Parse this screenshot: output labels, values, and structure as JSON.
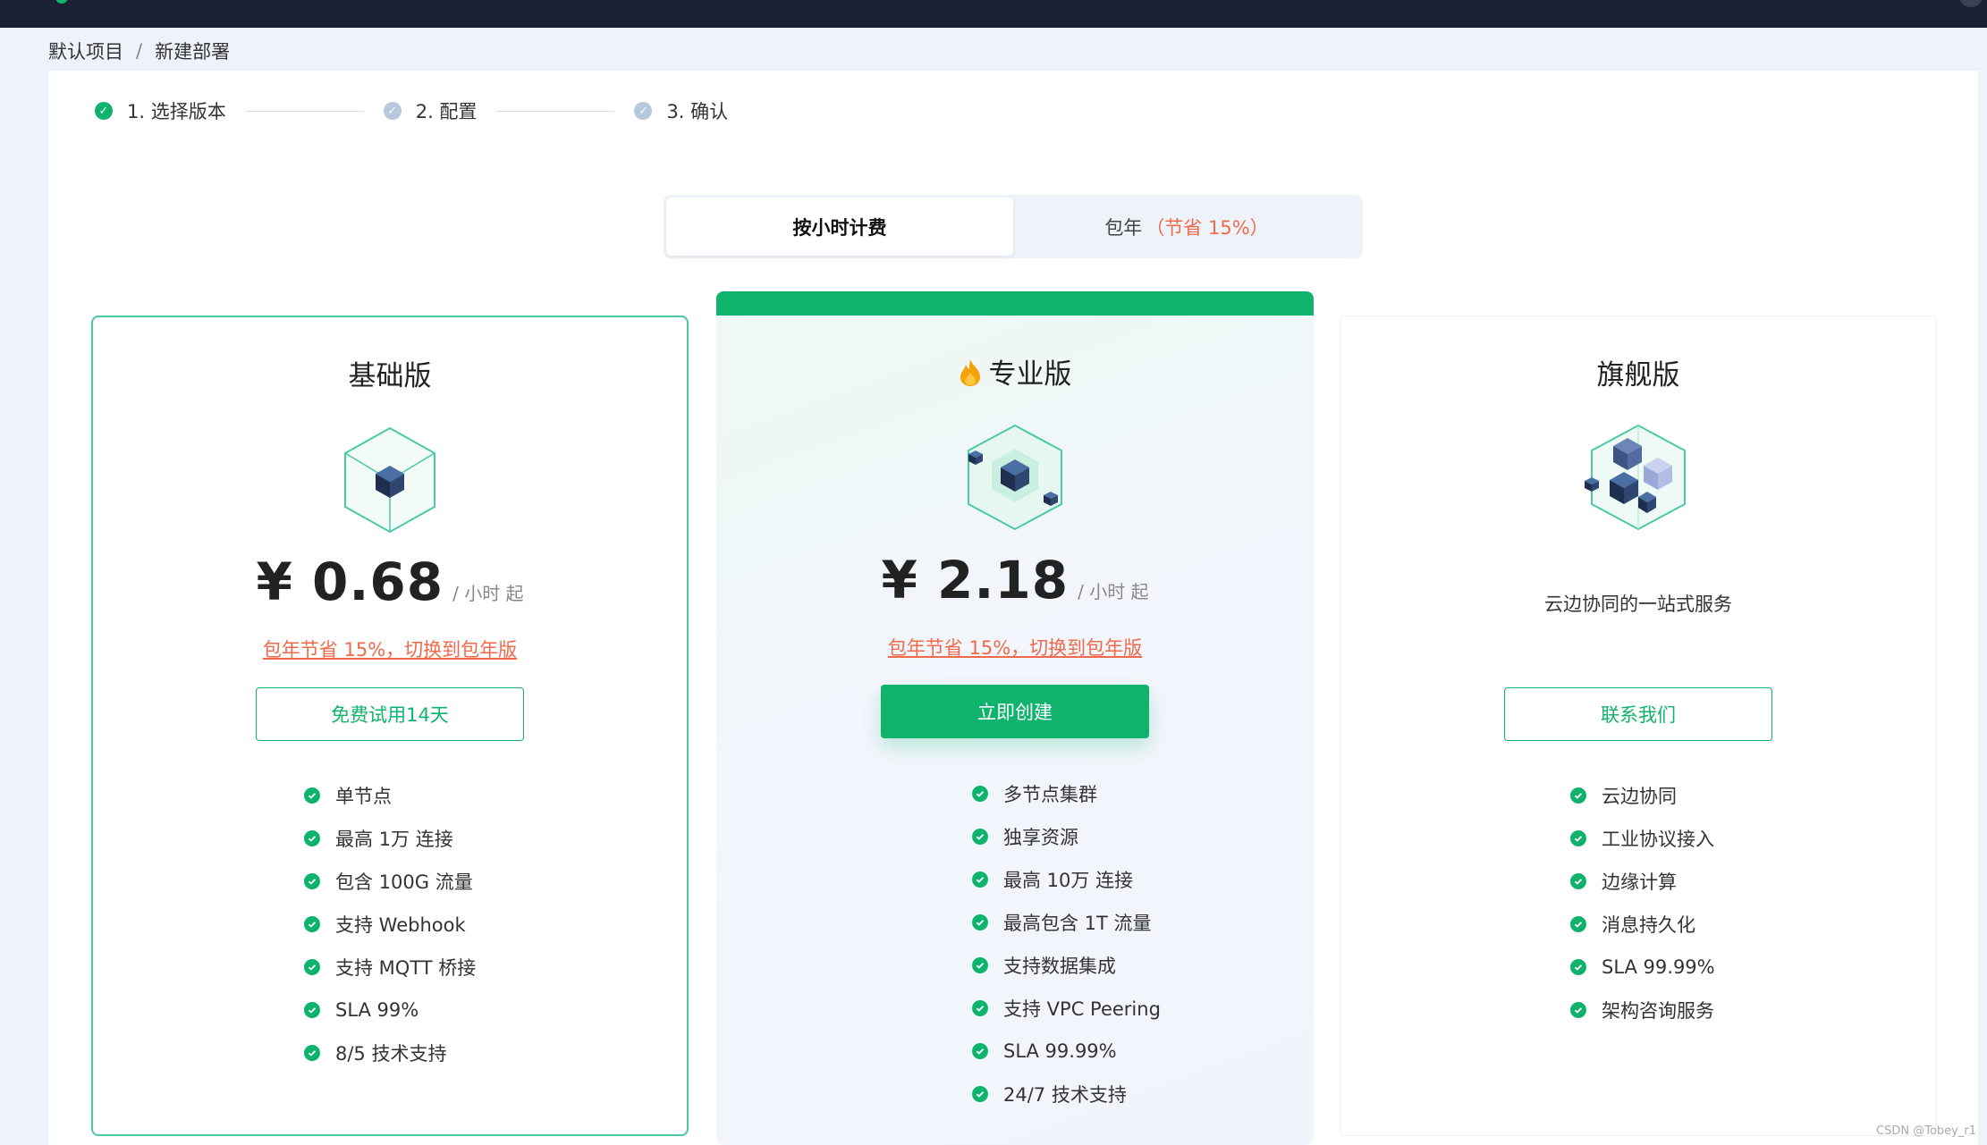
{
  "breadcrumb": [
    "默认项目",
    "/",
    "新建部署"
  ],
  "steps": [
    {
      "label": "1. 选择版本",
      "state": "done"
    },
    {
      "label": "2. 配置",
      "state": "todo"
    },
    {
      "label": "3. 确认",
      "state": "todo"
    }
  ],
  "billing": {
    "hourly": "按小时计费",
    "yearly": "包年",
    "yearly_save": "（节省 15%）",
    "selected": "hourly"
  },
  "plans": {
    "basic": {
      "title": "基础版",
      "price": "¥ 0.68",
      "unit": "/ 小时 起",
      "promo": "包年节省 15%，切换到包年版",
      "button": "免费试用14天",
      "features": [
        "单节点",
        "最高 1万 连接",
        "包含 100G 流量",
        "支持 Webhook",
        "支持 MQTT 桥接",
        "SLA 99%",
        "8/5 技术支持"
      ]
    },
    "pro": {
      "title": "专业版",
      "icon": "fire-icon",
      "price": "¥ 2.18",
      "unit": "/ 小时 起",
      "promo": "包年节省 15%，切换到包年版",
      "button": "立即创建",
      "features": [
        "多节点集群",
        "独享资源",
        "最高 10万 连接",
        "最高包含 1T 流量",
        "支持数据集成",
        "支持 VPC Peering",
        "SLA 99.99%",
        "24/7 技术支持"
      ]
    },
    "flagship": {
      "title": "旗舰版",
      "tagline": "云边协同的一站式服务",
      "button": "联系我们",
      "features": [
        "云边协同",
        "工业协议接入",
        "边缘计算",
        "消息持久化",
        "SLA 99.99%",
        "架构咨询服务"
      ]
    }
  },
  "watermark": "CSDN @Tobey_r1",
  "colors": {
    "accent": "#10b36b",
    "promo": "#ef6a4a",
    "topbar": "#1b2132"
  }
}
